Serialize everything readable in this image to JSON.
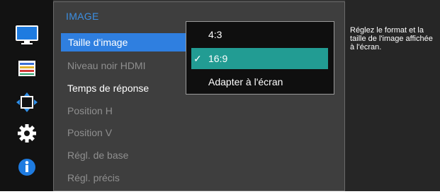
{
  "sidebar": {
    "icons": [
      "monitor-icon",
      "color-bars-icon",
      "resize-arrows-icon",
      "gear-icon",
      "info-icon"
    ]
  },
  "menu": {
    "section_title": "IMAGE",
    "items": [
      {
        "label": "Taille d'image",
        "state": "selected"
      },
      {
        "label": "Niveau noir HDMI",
        "state": "disabled"
      },
      {
        "label": "Temps de réponse",
        "state": "enabled"
      },
      {
        "label": "Position H",
        "state": "disabled"
      },
      {
        "label": "Position V",
        "state": "disabled"
      },
      {
        "label": "Régl. de base",
        "state": "disabled"
      },
      {
        "label": "Régl. précis",
        "state": "disabled"
      }
    ]
  },
  "submenu": {
    "options": [
      {
        "label": "4:3",
        "checked": false
      },
      {
        "label": "16:9",
        "checked": true
      },
      {
        "label": "Adapter à l'écran",
        "checked": false
      }
    ],
    "check_glyph": "✓"
  },
  "help": {
    "text": "Réglez le format et la taille de l'image affichée à l'écran."
  },
  "colors": {
    "accent_blue": "#2f7fe0",
    "selection_teal": "#229c93",
    "title_blue": "#3c8fe3"
  }
}
